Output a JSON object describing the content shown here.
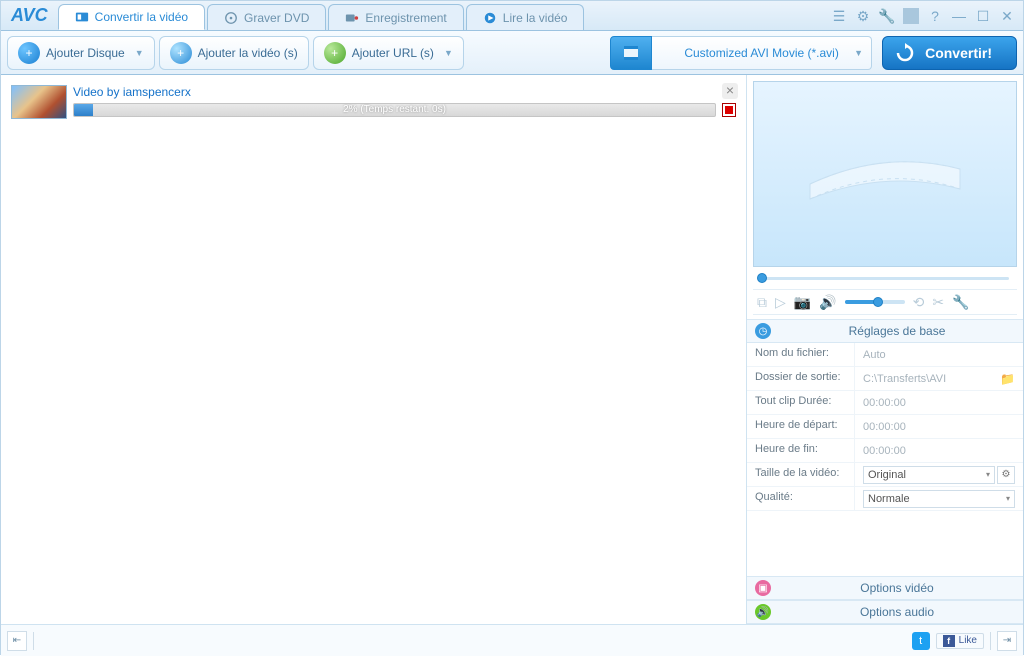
{
  "app": {
    "logo": "AVC"
  },
  "tabs": {
    "convert": "Convertir la vidéo",
    "burn": "Graver DVD",
    "record": "Enregistrement",
    "play": "Lire la vidéo"
  },
  "toolbar": {
    "add_disc": "Ajouter Disque",
    "add_video": "Ajouter la vidéo (s)",
    "add_url": "Ajouter URL (s)",
    "profile": "Customized AVI Movie (*.avi)",
    "convert": "Convertir!"
  },
  "video_item": {
    "title": "Video by iamspencerx",
    "progress_text": "2% (Temps restant: 0s)",
    "progress_pct": 3
  },
  "panels": {
    "base": {
      "title": "Réglages de base",
      "filename_label": "Nom du fichier:",
      "filename_value": "Auto",
      "outdir_label": "Dossier de sortie:",
      "outdir_value": "C:\\Transferts\\AVI",
      "duration_label": "Tout clip Durée:",
      "duration_value": "00:00:00",
      "start_label": "Heure de départ:",
      "start_value": "00:00:00",
      "end_label": "Heure de fin:",
      "end_value": "00:00:00",
      "size_label": "Taille de la vidéo:",
      "size_value": "Original",
      "quality_label": "Qualité:",
      "quality_value": "Normale"
    },
    "video_opts": "Options vidéo",
    "audio_opts": "Options audio"
  },
  "footer": {
    "like": "Like"
  }
}
